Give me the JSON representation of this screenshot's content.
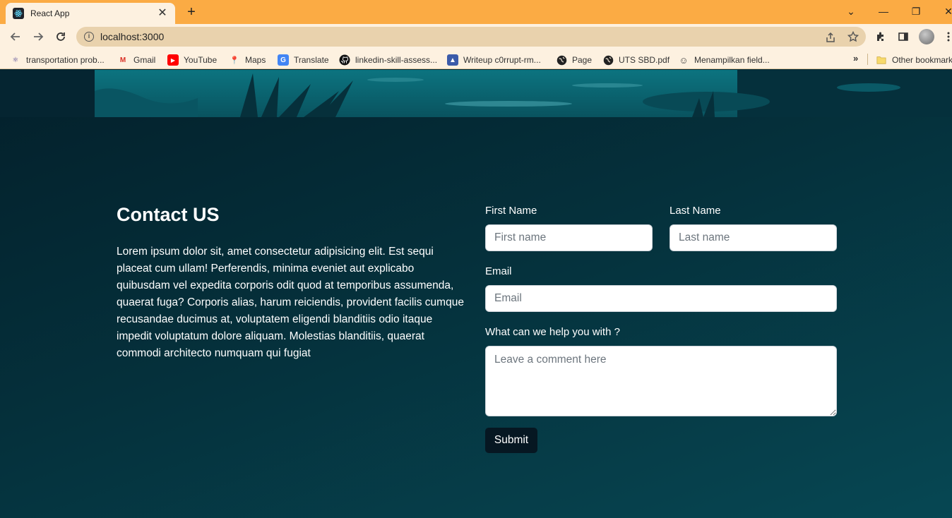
{
  "browser": {
    "tab": {
      "title": "React App",
      "close": "✕"
    },
    "new_tab": "+",
    "window_controls": {
      "dropdown": "⌄",
      "minimize": "—",
      "restore": "❐",
      "close": "✕"
    },
    "url": "localhost:3000",
    "bookmarks": [
      {
        "label": "transportation prob...",
        "icon": "react-icon",
        "glyph": "⚛",
        "color": "#4b3f8f"
      },
      {
        "label": "Gmail",
        "icon": "gmail-icon",
        "glyph": "M",
        "color": "#d93025"
      },
      {
        "label": "YouTube",
        "icon": "youtube-icon",
        "glyph": "▶",
        "color": "#ff0000"
      },
      {
        "label": "Maps",
        "icon": "maps-icon",
        "glyph": "📍",
        "color": "#34a853"
      },
      {
        "label": "Translate",
        "icon": "translate-icon",
        "glyph": "G",
        "color": "#4285f4"
      },
      {
        "label": "linkedin-skill-assess...",
        "icon": "github-icon",
        "glyph": "●",
        "color": "#111111"
      },
      {
        "label": "Writeup c0rrupt-rm...",
        "icon": "image-icon",
        "glyph": "▲",
        "color": "#3b5ba9"
      },
      {
        "label": "Page",
        "icon": "globe-icon",
        "glyph": "🌐",
        "color": "#222222"
      },
      {
        "label": "UTS SBD.pdf",
        "icon": "globe-icon",
        "glyph": "🌐",
        "color": "#222222"
      },
      {
        "label": "Menampilkan field...",
        "icon": "person-icon",
        "glyph": "☺",
        "color": "#444444"
      }
    ],
    "more_bookmarks": "»",
    "other_bookmarks": "Other bookmarks"
  },
  "contact": {
    "title": "Contact US",
    "text": "Lorem ipsum dolor sit, amet consectetur adipisicing elit. Est sequi placeat cum ullam! Perferendis, minima eveniet aut explicabo quibusdam vel expedita corporis odit quod at temporibus assumenda, quaerat fuga? Corporis alias, harum reiciendis, provident facilis cumque recusandae ducimus at, voluptatem eligendi blanditiis odio itaque impedit voluptatum dolore aliquam. Molestias blanditiis, quaerat commodi architecto numquam qui fugiat"
  },
  "form": {
    "first_name": {
      "label": "First Name",
      "placeholder": "First name",
      "value": ""
    },
    "last_name": {
      "label": "Last Name",
      "placeholder": "Last name",
      "value": ""
    },
    "email": {
      "label": "Email",
      "placeholder": "Email",
      "value": ""
    },
    "comment": {
      "label": "What can we help you with ?",
      "placeholder": "Leave a comment here",
      "value": ""
    },
    "submit": "Submit"
  },
  "colors": {
    "tabbar": "#fbab44",
    "toolbar": "#fdf1e0",
    "page_dark": "#03202b",
    "page_teal": "#064753",
    "button": "#061722"
  }
}
